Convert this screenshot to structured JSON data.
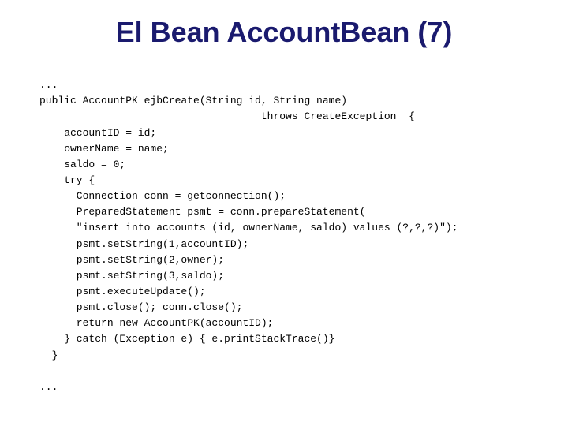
{
  "slide": {
    "title": "El Bean AccountBean (7)",
    "code_lines": [
      "...",
      "public AccountPK ejbCreate(String id, String name)",
      "                                    throws CreateException  {",
      "    accountID = id;",
      "    ownerName = name;",
      "    saldo = 0;",
      "    try {",
      "      Connection conn = getconnection();",
      "      PreparedStatement psmt = conn.prepareStatement(",
      "      \"insert into accounts (id, ownerName, saldo) values (?,?,?)\");",
      "      psmt.setString(1,accountID);",
      "      psmt.setString(2,owner);",
      "      psmt.setString(3,saldo);",
      "      psmt.executeUpdate();",
      "      psmt.close(); conn.close();",
      "      return new AccountPK(accountID);",
      "    } catch (Exception e) { e.printStackTrace()}",
      "  }",
      "",
      "..."
    ]
  }
}
